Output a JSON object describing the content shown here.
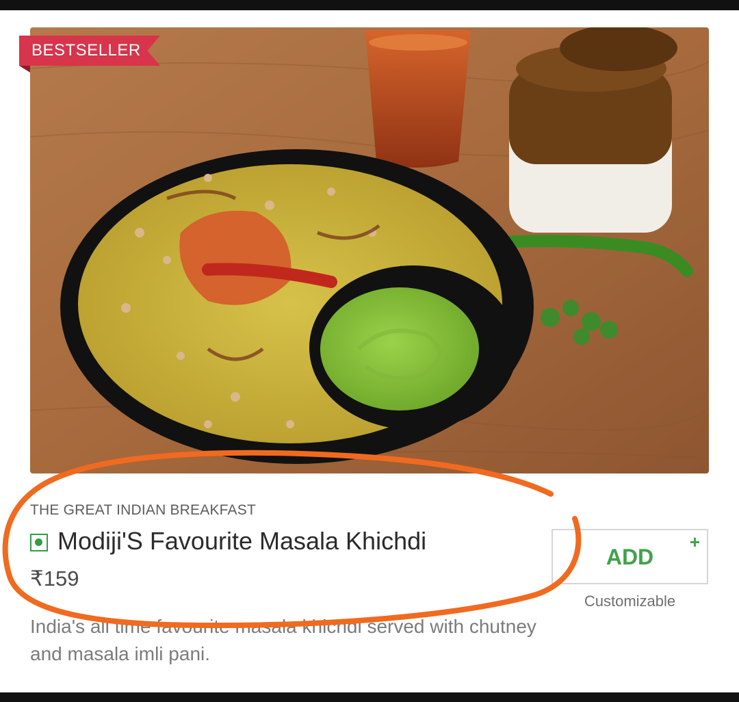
{
  "badge": {
    "label": "BESTSELLER"
  },
  "item": {
    "category": "THE GREAT INDIAN BREAKFAST",
    "name": "Modiji'S Favourite Masala Khichdi",
    "price": "₹159",
    "description": "India's all time favourite masala khichdi served with chutney and masala imli pani.",
    "diet_icon": "veg-icon",
    "diet_color": "#2f9e44"
  },
  "add_button": {
    "label": "ADD",
    "plus": "+",
    "note": "Customizable"
  },
  "colors": {
    "badge": "#d8344b",
    "accent_green": "#3fa24b",
    "annotation": "#f06a1f"
  }
}
